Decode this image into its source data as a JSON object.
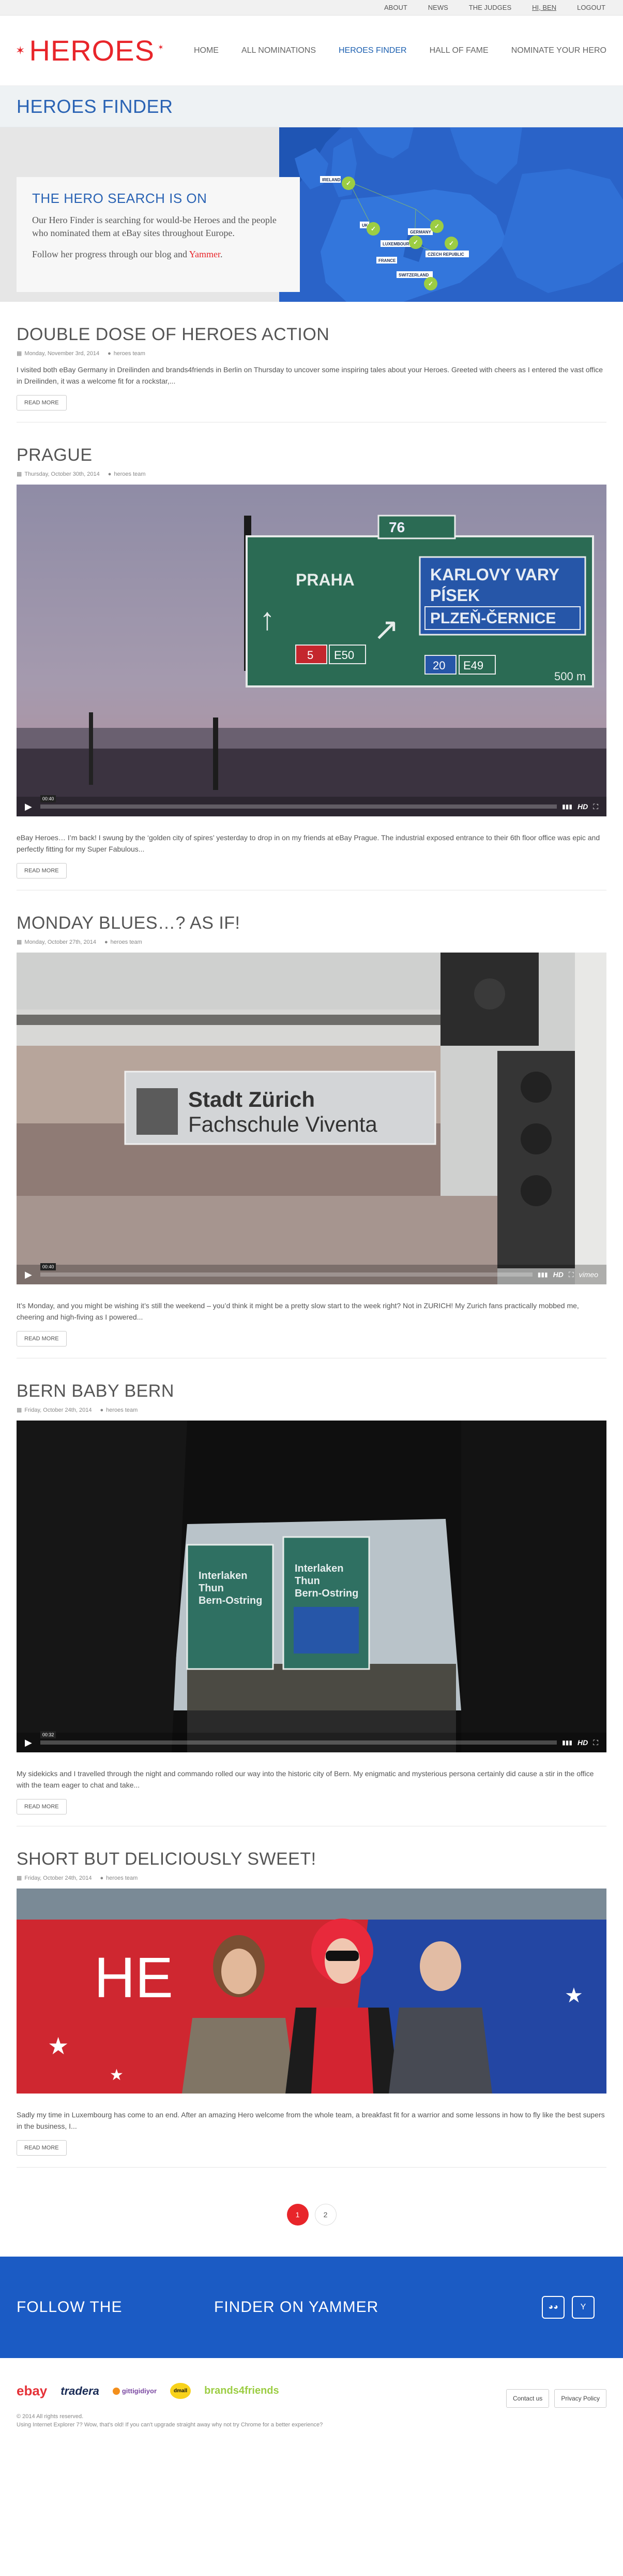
{
  "topbar": {
    "links": [
      "ABOUT",
      "NEWS",
      "THE JUDGES",
      "HI, BEN",
      "LOGOUT"
    ]
  },
  "brand": {
    "logo_text": "HEROES",
    "accent": "#e8252a",
    "primary": "#1b5bc4"
  },
  "nav": {
    "items": [
      "HOME",
      "ALL NOMINATIONS",
      "HEROES FINDER",
      "HALL OF FAME",
      "NOMINATE YOUR HERO"
    ],
    "active": "HEROES FINDER"
  },
  "page": {
    "title": "HEROES FINDER"
  },
  "hero": {
    "heading": "THE HERO SEARCH IS ON",
    "body": "Our Hero Finder is searching for would-be Heroes and the people who nominated them at eBay sites throughout Europe.",
    "follow_prefix": "Follow her progress through our blog and ",
    "follow_link": "Yammer",
    "follow_suffix": ".",
    "map_labels": [
      "IRELAND",
      "UK",
      "GERMANY",
      "LUXEMBOURG",
      "CZECH REPUBLIC",
      "FRANCE",
      "SWITZERLAND"
    ]
  },
  "posts": [
    {
      "title": "DOUBLE DOSE OF HEROES ACTION",
      "date": "Monday, November 3rd, 2014",
      "author": "heroes team",
      "media": "none",
      "excerpt": "I visited both eBay Germany in Dreilinden and brands4friends in Berlin on Thursday to uncover some inspiring tales about your Heroes. Greeted with cheers as I entered the vast office in Dreilinden, it was a welcome fit for a rockstar,...",
      "read_more": "READ MORE"
    },
    {
      "title": "PRAGUE",
      "date": "Thursday, October 30th, 2014",
      "author": "heroes team",
      "media": "video-prague",
      "video_time": "00:40",
      "sign": {
        "city": "PRAHA",
        "dest1": "KARLOVY VARY",
        "dest2": "PÍSEK",
        "dest3": "PLZEŇ-ČERNICE",
        "road": "76",
        "exit1": "5",
        "exit2": "E50",
        "exit3": "20",
        "exit4": "E49",
        "distance": "500 m"
      },
      "excerpt": "eBay Heroes… I’m back! I swung by the ‘golden city of spires’ yesterday to drop in on my friends at eBay Prague. The industrial exposed entrance to their 6th floor office was epic and perfectly fitting for my Super Fabulous...",
      "read_more": "READ MORE"
    },
    {
      "title": "MONDAY BLUES…? AS IF!",
      "date": "Monday, October 27th, 2014",
      "author": "heroes team",
      "media": "video-zurich",
      "video_time": "00:40",
      "sign": {
        "line1": "Stadt Zürich",
        "line2": "Fachschule Viventa"
      },
      "player_brand": "vimeo",
      "excerpt": "It’s Monday,  and you might be wishing it’s still the weekend – you’d think it might be a pretty slow start to the week right?  Not in ZURICH! My Zurich fans practically mobbed me, cheering and high-fiving as I powered...",
      "read_more": "READ MORE"
    },
    {
      "title": "BERN BABY BERN",
      "date": "Friday, October 24th, 2014",
      "author": "heroes team",
      "media": "video-bern",
      "video_time": "00:32",
      "sign": {
        "left": [
          "Interlaken",
          "Thun",
          "Bern-Ostring"
        ],
        "right": [
          "Interlaken",
          "Thun",
          "Bern-Ostring"
        ]
      },
      "excerpt": "My sidekicks and I travelled through the night and commando rolled our way into the historic city of Bern. My enigmatic and mysterious persona certainly did cause a stir in the office with the team eager to chat and take...",
      "read_more": "READ MORE"
    },
    {
      "title": "SHORT BUT DELICIOUSLY SWEET!",
      "date": "Friday, October 24th, 2014",
      "author": "heroes team",
      "media": "photo-luxembourg",
      "excerpt": "Sadly my time in Luxembourg has come to an end. After an amazing Hero welcome from the whole team, a breakfast fit for a warrior and some lessons in how to fly like the best supers in the business, I...",
      "read_more": "READ MORE"
    }
  ],
  "pagination": {
    "current": "1",
    "next": "2"
  },
  "follow": {
    "left": "FOLLOW THE",
    "right": "FINDER ON YAMMER"
  },
  "footer": {
    "partners": [
      "ebay",
      "tradera",
      "gittigidiyor",
      "dmall",
      "brands4friends"
    ],
    "copyright": "© 2014 All rights reserved.",
    "browser_note": "Using Internet Explorer 7? Wow, that's old! If you can't upgrade straight away why not try Chrome for a better experience?",
    "contact": "Contact us",
    "privacy": "Privacy Policy"
  }
}
